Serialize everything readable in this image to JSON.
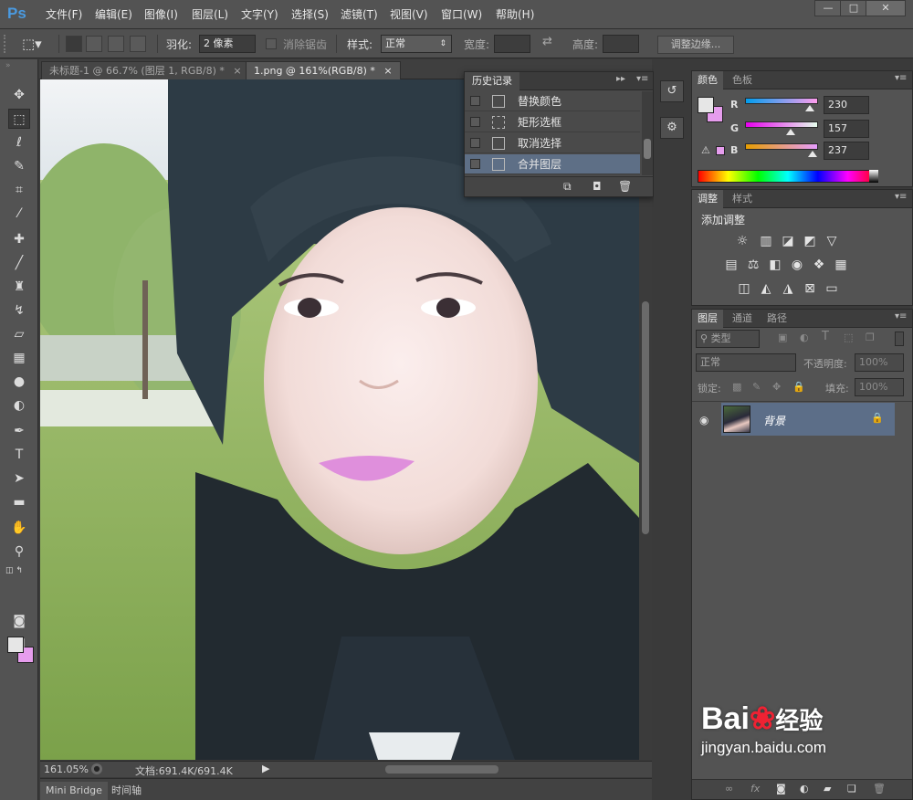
{
  "app": {
    "logo": "Ps"
  },
  "menu": [
    "文件(F)",
    "编辑(E)",
    "图像(I)",
    "图层(L)",
    "文字(Y)",
    "选择(S)",
    "滤镜(T)",
    "视图(V)",
    "窗口(W)",
    "帮助(H)"
  ],
  "options": {
    "feather_label": "羽化:",
    "feather_value": "2 像素",
    "antialias_label": "消除锯齿",
    "style_label": "样式:",
    "style_value": "正常",
    "width_label": "宽度:",
    "height_label": "高度:",
    "refine_edge": "调整边缘..."
  },
  "tabs": [
    {
      "label": "未标题-1 @ 66.7% (图层 1, RGB/8) *",
      "close": "×"
    },
    {
      "label": "1.png @ 161%(RGB/8) *",
      "close": "×"
    }
  ],
  "history": {
    "title": "历史记录",
    "items": [
      "替换颜色",
      "矩形选框",
      "取消选择",
      "合并图层"
    ]
  },
  "status": {
    "zoom": "161.05%",
    "doc": "文档:691.4K/691.4K"
  },
  "bottom_tabs": [
    "Mini Bridge",
    "时间轴"
  ],
  "color_panel": {
    "tabs": [
      "颜色",
      "色板"
    ],
    "r_label": "R",
    "g_label": "G",
    "b_label": "B",
    "r": 230,
    "g": 157,
    "b": 237
  },
  "adjust_panel": {
    "tabs": [
      "调整",
      "样式"
    ],
    "title": "添加调整"
  },
  "layers_panel": {
    "tabs": [
      "图层",
      "通道",
      "路径"
    ],
    "filter_kind": "类型",
    "blend_mode": "正常",
    "opacity_label": "不透明度:",
    "opacity": "100%",
    "lock_label": "锁定:",
    "fill_label": "填充:",
    "fill": "100%",
    "layer_name": "背景"
  },
  "watermark": {
    "brand": "Bai",
    "brand_cn": "经验",
    "url": "jingyan.baidu.com"
  },
  "colors": {
    "fg": "#e6e6e6",
    "bg": "#e69ded",
    "accent": "#5c6e88"
  }
}
